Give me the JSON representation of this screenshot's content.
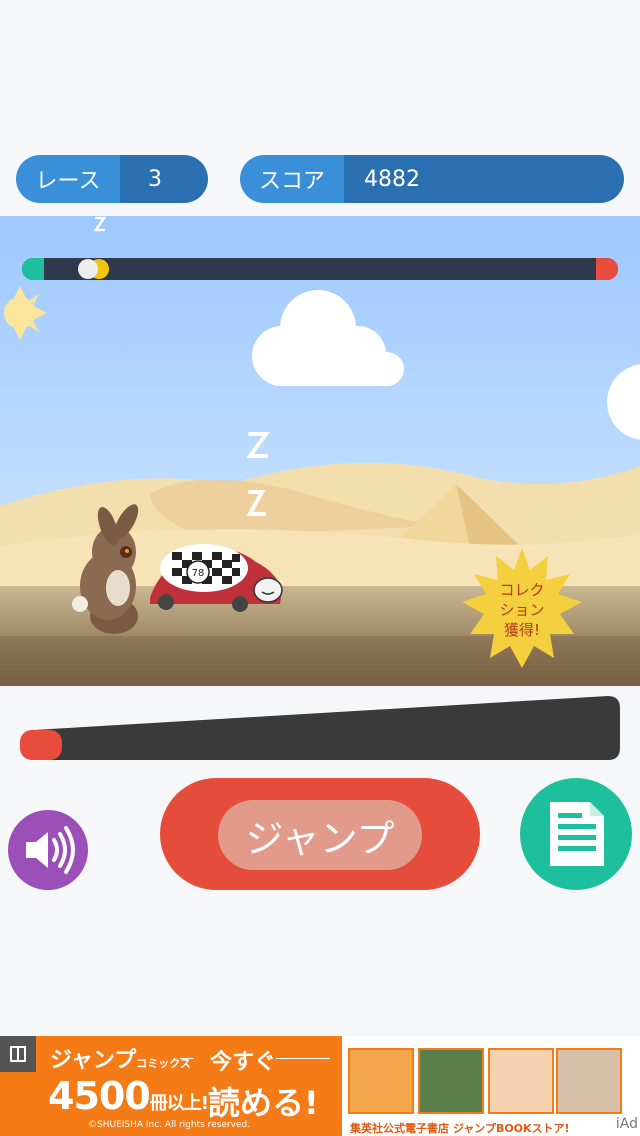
{
  "header": {
    "race": {
      "label": "レース",
      "value": "3"
    },
    "score": {
      "label": "スコア",
      "value": "4882"
    }
  },
  "race_progress": {
    "start_color": "#1dbf9c",
    "finish_color": "#e74c3c",
    "track_color": "#2e3a4c",
    "rabbit_position": 0.11,
    "turtle_position": 0.13
  },
  "scene": {
    "setting": "desert",
    "icons": [
      "sun-icon",
      "cloud-icon",
      "pyramid-icon",
      "rabbit-icon",
      "turtle-car-icon",
      "sleep-zz-icon"
    ]
  },
  "collection_badge": {
    "lines": [
      "コレク",
      "ション",
      "獲得!"
    ]
  },
  "power_meter": {
    "fill_color": "#e74c3c",
    "track_color": "#3a3a3a",
    "level": 0.07
  },
  "controls": {
    "jump_label": "ジャンプ",
    "sound_icon": "speaker-icon",
    "notes_icon": "document-icon"
  },
  "ad": {
    "brand": "ジャンプ",
    "brand_small": "コミックス",
    "count": "4500",
    "count_suffix": "冊以上!",
    "now1": "今すぐ",
    "now2": "読める!",
    "copyright": "©SHUEISHA Inc. All rights reserved.",
    "store": "集英社公式電子書店 ジャンプBOOKストア!",
    "iad": "iAd"
  },
  "colors": {
    "pill_label": "#3a8fd9",
    "pill_value": "#2a6fb0",
    "jump_button": "#e64c3c",
    "sound_button": "#9b4fb8",
    "notes_button": "#1dbf9c",
    "ad_orange": "#f47b16"
  }
}
